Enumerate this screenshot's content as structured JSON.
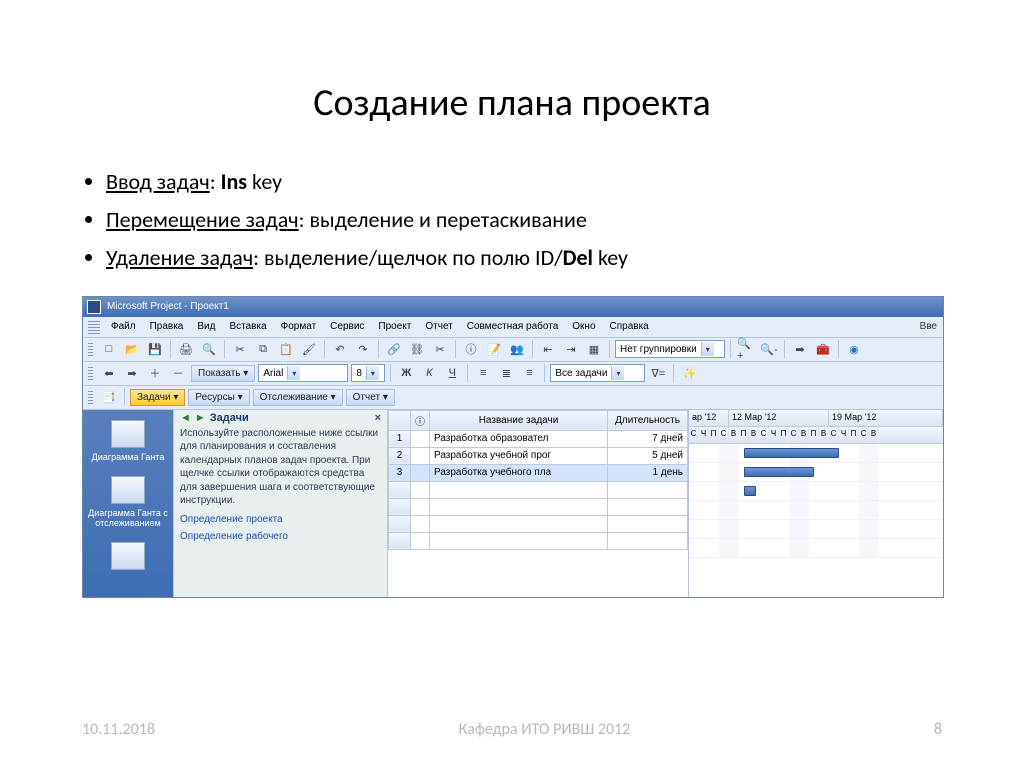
{
  "title": "Создание плана проекта",
  "bullets": {
    "b1_u": "Ввод задач",
    "b1_rest": ": ",
    "b1_bold": "Ins",
    "b1_tail": " key",
    "b2_u": "Перемещение задач",
    "b2_rest": ": выделение и перетаскивание",
    "b3_u": "Удаление задач",
    "b3_rest": ": выделение/щелчок по полю ID/",
    "b3_bold": "Del",
    "b3_tail": " key"
  },
  "app": {
    "titlebar": "Microsoft Project - Проект1",
    "menu": [
      "Файл",
      "Правка",
      "Вид",
      "Вставка",
      "Формат",
      "Сервис",
      "Проект",
      "Отчет",
      "Совместная работа",
      "Окно",
      "Справка"
    ],
    "menu_right": "Вве",
    "tb2": {
      "show": "Показать ▾",
      "font": "Arial",
      "size": "8",
      "all": "Все задачи",
      "group": "Нет группировки"
    },
    "tabs": {
      "t1": "Задачи ▾",
      "t2": "Ресурсы ▾",
      "t3": "Отслеживание ▾",
      "t4": "Отчет ▾"
    },
    "leftnav": {
      "i1": "Диаграмма Ганта",
      "i2": "Диаграмма Ганта с отслеживанием"
    },
    "guide": {
      "title": "Задачи",
      "text": "Используйте расположенные ниже ссылки для планирования и составления календарных планов задач проекта. При щелчке ссылки отображаются средства для завершения шага и соответствующие инструкции.",
      "link1": "Определение проекта",
      "link2": "Определение рабочего"
    },
    "grid": {
      "h_info": "ⓘ",
      "h_name": "Название задачи",
      "h_dur": "Длительность",
      "rows": [
        {
          "id": "1",
          "name": "Разработка образовател",
          "dur": "7 дней"
        },
        {
          "id": "2",
          "name": "Разработка учебной прог",
          "dur": "5 дней"
        },
        {
          "id": "3",
          "name": "Разработка учебного пла",
          "dur": "1 день"
        }
      ]
    },
    "gantt": {
      "weeks": [
        "ар '12",
        "12 Мар '12",
        "19 Мар '12"
      ],
      "days": "СЧПСВПВСЧПСВПВСЧПСВ"
    }
  },
  "footer": {
    "date": "10.11.2018",
    "center": "Кафедра ИТО РИВШ 2012",
    "page": "8"
  }
}
